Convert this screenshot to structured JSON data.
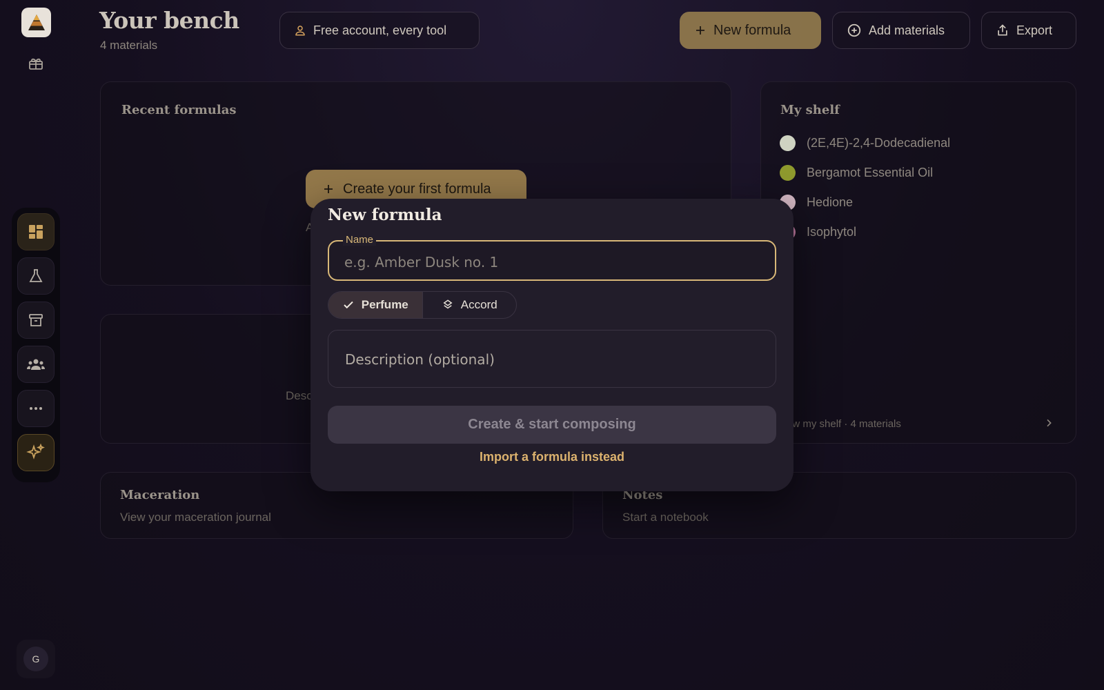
{
  "header": {
    "title": "Your bench",
    "subtitle": "4 materials",
    "account_label": "Free account, every tool",
    "new_formula_label": "New formula",
    "add_materials_label": "Add materials",
    "export_label": "Export"
  },
  "recent": {
    "title": "Recent formulas",
    "create_first_label": "Create your first formula",
    "hint_fragment": "A"
  },
  "mid_card": {
    "desc_fragment": "Desc"
  },
  "shelf": {
    "title": "My shelf",
    "items": [
      {
        "name": "(2E,4E)-2,4-Dodecadienal",
        "color": "#cfd3c2"
      },
      {
        "name": "Bergamot Essential Oil",
        "color": "#8f9a2e"
      },
      {
        "name": "Hedione",
        "color": "#d4b8c4"
      },
      {
        "name": "Isophytol",
        "color": "#c07aa0"
      }
    ],
    "footer": "ew my shelf · 4 materials"
  },
  "maceration": {
    "title": "Maceration",
    "subtitle": "View your maceration journal"
  },
  "notes": {
    "title": "Notes",
    "subtitle": "Start a notebook"
  },
  "modal": {
    "title": "New formula",
    "name_label": "Name",
    "name_placeholder": "e.g. Amber Dusk no. 1",
    "type_options": [
      "Perfume",
      "Accord"
    ],
    "selected_type": "Perfume",
    "description_placeholder": "Description (optional)",
    "submit_label": "Create & start composing",
    "import_label": "Import a formula instead"
  },
  "user": {
    "initial": "G"
  },
  "colors": {
    "accent": "#d9b878",
    "button_gold": "#a98b52"
  }
}
